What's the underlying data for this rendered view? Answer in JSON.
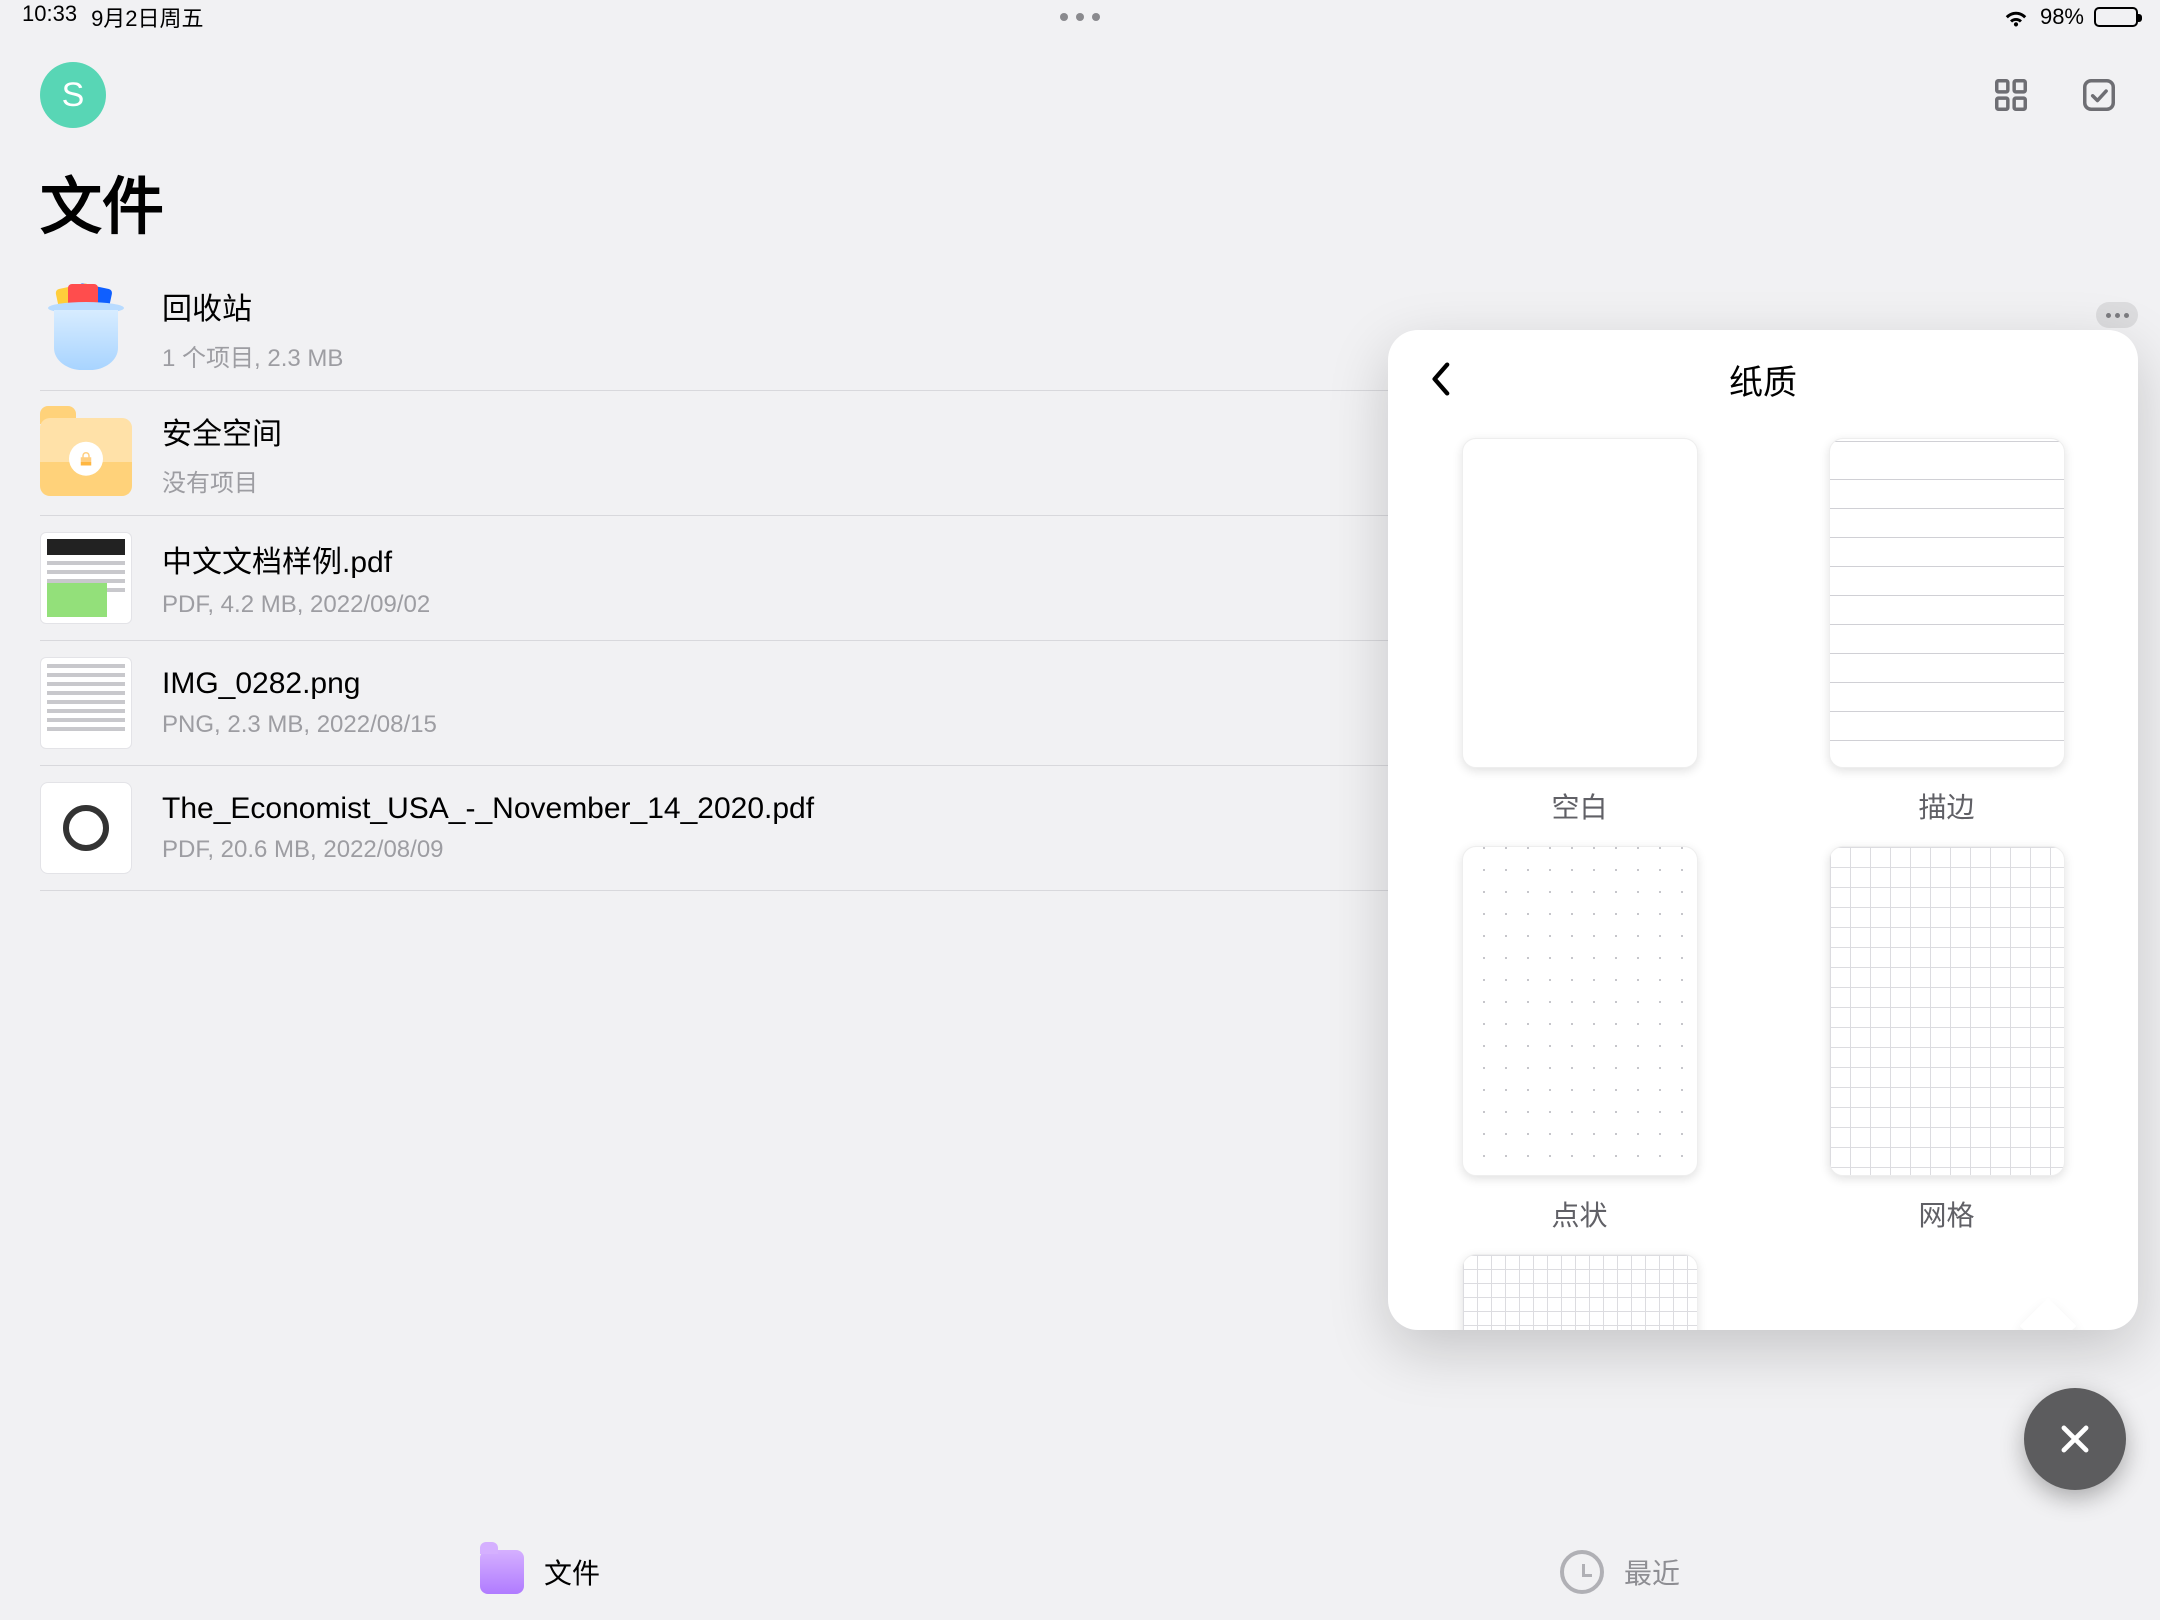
{
  "status": {
    "time": "10:33",
    "date": "9月2日周五",
    "battery_pct": "98%",
    "battery_fill": 98
  },
  "header": {
    "avatar_initial": "S",
    "page_title": "文件"
  },
  "files": [
    {
      "type": "trash",
      "title": "回收站",
      "meta": "1 个项目, 2.3 MB"
    },
    {
      "type": "secure",
      "title": "安全空间",
      "meta": "没有项目"
    },
    {
      "type": "pdf-a",
      "title": "中文文档样例.pdf",
      "meta": "PDF, 4.2 MB, 2022/09/02"
    },
    {
      "type": "img",
      "title": "IMG_0282.png",
      "meta": "PNG, 2.3 MB, 2022/08/15"
    },
    {
      "type": "pdf-b",
      "title": "The_Economist_USA_-_November_14_2020.pdf",
      "meta": "PDF, 20.6 MB, 2022/08/09"
    }
  ],
  "tabs": {
    "files": "文件",
    "recent": "最近"
  },
  "popup": {
    "title": "纸质",
    "options": [
      {
        "label": "空白",
        "cls": ""
      },
      {
        "label": "描边",
        "cls": "swatch-ruled"
      },
      {
        "label": "点状",
        "cls": "swatch-dot"
      },
      {
        "label": "网格",
        "cls": "swatch-grid"
      },
      {
        "label": "",
        "cls": "swatch-quad"
      }
    ]
  }
}
